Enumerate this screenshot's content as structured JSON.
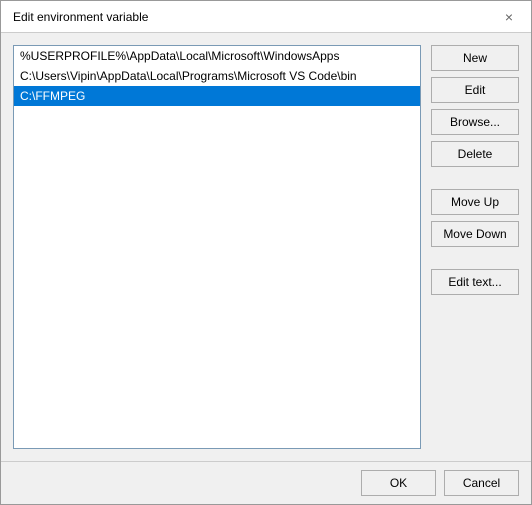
{
  "dialog": {
    "title": "Edit environment variable",
    "close_label": "×"
  },
  "list": {
    "items": [
      {
        "value": "%USERPROFILE%\\AppData\\Local\\Microsoft\\WindowsApps",
        "selected": false
      },
      {
        "value": "C:\\Users\\Vipin\\AppData\\Local\\Programs\\Microsoft VS Code\\bin",
        "selected": false
      },
      {
        "value": "C:\\FFMPEG",
        "selected": true
      }
    ]
  },
  "buttons": {
    "new": "New",
    "edit": "Edit",
    "browse": "Browse...",
    "delete": "Delete",
    "move_up": "Move Up",
    "move_down": "Move Down",
    "edit_text": "Edit text..."
  },
  "footer": {
    "ok": "OK",
    "cancel": "Cancel"
  }
}
